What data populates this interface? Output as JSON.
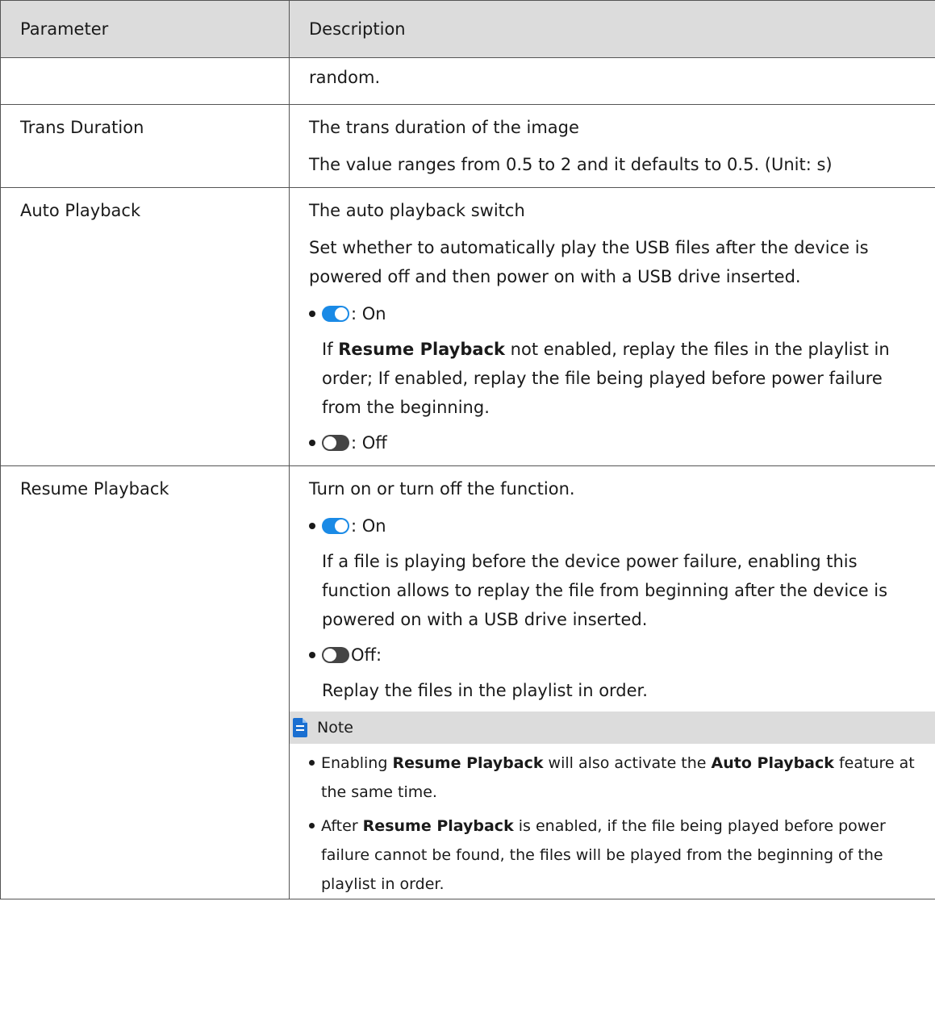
{
  "table": {
    "headers": [
      "Parameter",
      "Description"
    ],
    "row_random": {
      "text": "random."
    },
    "row_trans": {
      "param": "Trans Duration",
      "line1": "The trans duration of the image",
      "line2": "The value ranges from 0.5 to 2 and it defaults to 0.5. (Unit: s)"
    },
    "row_auto": {
      "param": "Auto Playback",
      "line1": "The auto playback switch",
      "line2": "Set whether to automatically play the USB files after the device is powered off and then power on with a USB drive inserted.",
      "on_label": ": On",
      "on_desc_pre": "If ",
      "on_desc_bold": "Resume Playback",
      "on_desc_post": " not enabled, replay the files in the playlist in order; If enabled, replay the file being played before power failure from the beginning.",
      "off_label": ": Off"
    },
    "row_resume": {
      "param": "Resume Playback",
      "line1": "Turn on or turn off the function.",
      "on_label": ": On",
      "on_desc": "If a file is playing before the device power failure, enabling this function allows to replay the file from beginning after the device is powered on with a USB drive inserted.",
      "off_label": "Off:",
      "off_desc": "Replay the files in the playlist in order.",
      "note_label": "Note",
      "note1_pre": "Enabling ",
      "note1_b1": "Resume Playback",
      "note1_mid": " will also activate the ",
      "note1_b2": "Auto Playback",
      "note1_post": " feature at the same time.",
      "note2_pre": "After ",
      "note2_b1": "Resume Playback",
      "note2_post": " is enabled, if the file being played before power failure cannot be found, the files will be played from the beginning of the playlist in order."
    }
  },
  "colors": {
    "toggle_on": "#1a8ae6",
    "toggle_off": "#444444",
    "header_bg": "#dcdcdc",
    "note_icon": "#1a6fd1"
  },
  "icons": [
    "toggle-on-icon",
    "toggle-off-icon",
    "note-icon"
  ]
}
